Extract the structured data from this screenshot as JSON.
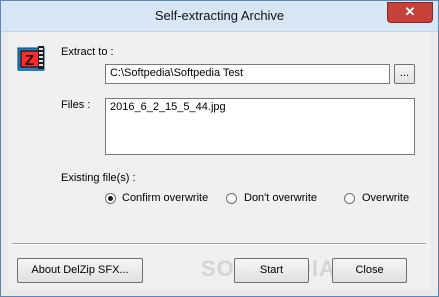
{
  "window": {
    "title": "Self-extracting Archive",
    "close_glyph": "✕"
  },
  "extract": {
    "label": "Extract to :",
    "path": "C:\\Softpedia\\Softpedia Test",
    "browse_label": "..."
  },
  "files": {
    "label": "Files :",
    "items": [
      "2016_6_2_15_5_44.jpg"
    ]
  },
  "existing": {
    "label": "Existing file(s) :",
    "options": [
      "Confirm overwrite",
      "Don't overwrite",
      "Overwrite"
    ],
    "selected": "Confirm overwrite"
  },
  "buttons": {
    "about": "About DelZip SFX...",
    "start": "Start",
    "close": "Close"
  },
  "watermark": "SOFTPEDIA",
  "icons": {
    "app": "zip-archive-icon"
  }
}
